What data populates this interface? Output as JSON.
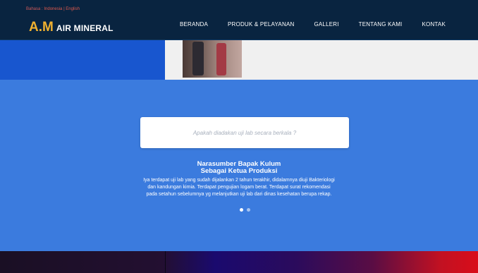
{
  "topbar": {
    "lang_prefix": "Bahasa :",
    "lang_id": "Indonesia",
    "lang_sep": "|",
    "lang_en": "English",
    "logo_mark": "A.M",
    "logo_text": "AIR MINERAL"
  },
  "nav": {
    "items": [
      {
        "label": "BERANDA"
      },
      {
        "label": "PRODUK & PELAYANAN"
      },
      {
        "label": "GALLERI"
      },
      {
        "label": "TENTANG KAMI"
      },
      {
        "label": "KONTAK"
      }
    ]
  },
  "testimonial": {
    "question": "Apakah diadakan uji lab secara berkala ?",
    "name": "Narasumber Bapak Kulum",
    "role": "Sebagai Ketua Produksi",
    "lines": [
      "Iya terdapat uji lab yang sudah dijalankan 2 tahun terakhir, didalamnya diuji Bakteriologi",
      "dan kandungan kimia. Terdapat pengujian logam berat. Terdapat surat rekomendasi",
      "pada setahun sebelumnya yg melanjutkan uji lab dari dinas kesehatan berupa rekap."
    ],
    "carousel": {
      "active": 1,
      "count": 2
    }
  },
  "colors": {
    "nav_bg": "#092440",
    "section_bg": "#3b7bde",
    "accent": "#f0b130"
  }
}
